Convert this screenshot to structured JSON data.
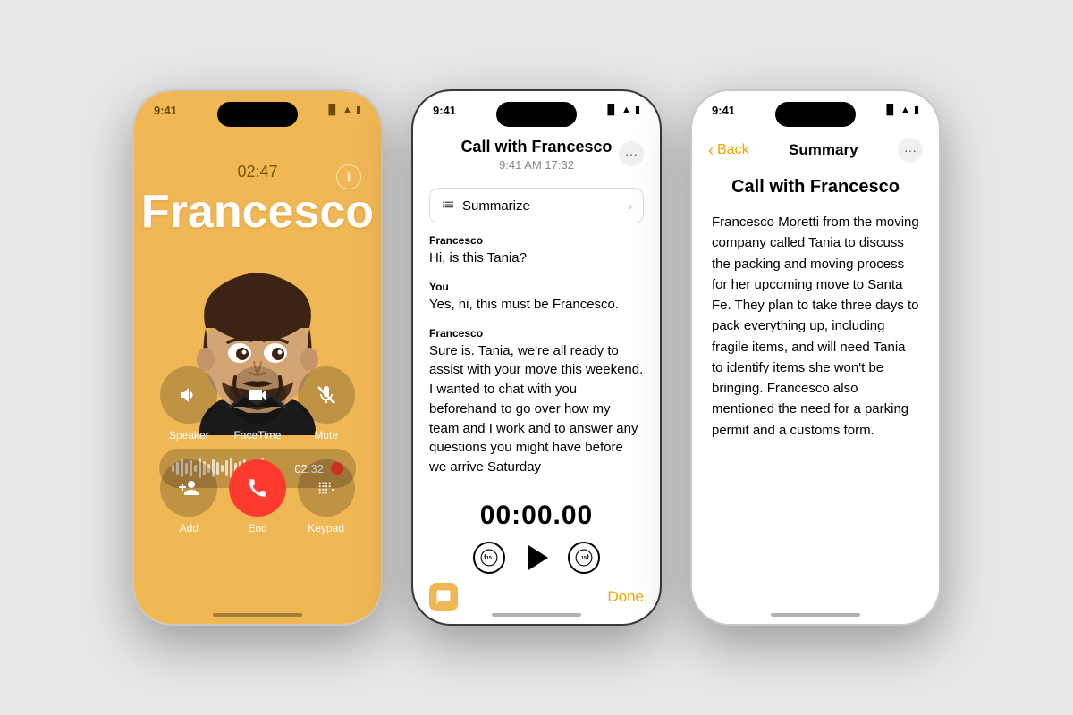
{
  "bg_color": "#e8e8e8",
  "phone1": {
    "status_time": "9:41",
    "call_duration": "02:47",
    "caller_name": "Francesco",
    "waveform_time": "02:32",
    "buttons": [
      {
        "label": "Speaker",
        "icon": "🔊"
      },
      {
        "label": "FaceTime",
        "icon": "📹"
      },
      {
        "label": "Mute",
        "icon": "🎤"
      },
      {
        "label": "Add",
        "icon": "👤"
      },
      {
        "label": "End",
        "icon": "📞"
      },
      {
        "label": "Keypad",
        "icon": "⌨️"
      }
    ]
  },
  "phone2": {
    "status_time": "9:41",
    "title": "Call with Francesco",
    "subtitle": "9:41 AM  17:32",
    "summarize_label": "Summarize",
    "transcript": [
      {
        "speaker": "Francesco",
        "text": "Hi, is this Tania?"
      },
      {
        "speaker": "You",
        "text": "Yes, hi, this must be Francesco."
      },
      {
        "speaker": "Francesco",
        "text": "Sure is. Tania, we're all ready to assist with your move this weekend. I wanted to chat with you beforehand to go over how my team and I work and to answer any questions you might have before we arrive Saturday"
      }
    ],
    "playback_time": "00:00.00",
    "done_label": "Done"
  },
  "phone3": {
    "status_time": "9:41",
    "back_label": "Back",
    "page_title": "Summary",
    "call_title": "Call with Francesco",
    "summary_text": "Francesco Moretti from the moving company called Tania to discuss the packing and moving process for her upcoming move to Santa Fe. They plan to take three days to pack everything up, including fragile items, and will need Tania to identify items she won't be bringing. Francesco also mentioned the need for a parking permit and a customs form."
  }
}
